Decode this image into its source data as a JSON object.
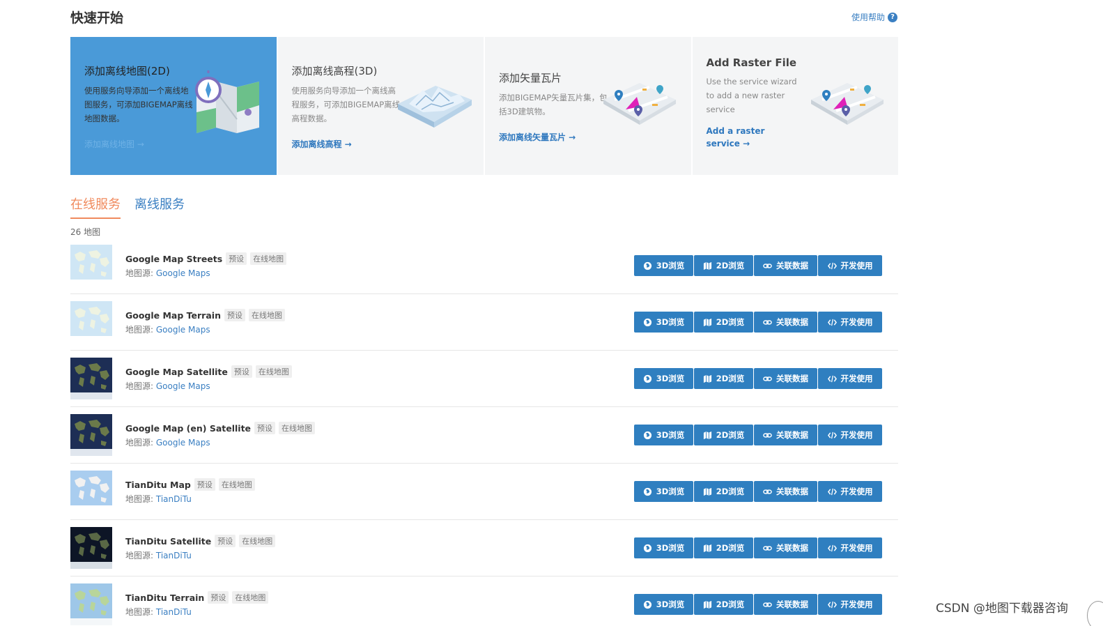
{
  "header": {
    "title": "快速开始",
    "help_label": "使用帮助",
    "help_icon": "question-circle-icon"
  },
  "cards": [
    {
      "title": "添加离线地图(2D)",
      "desc": "使用服务向导添加一个离线地图服务，可添加BIGEMAP离线地图数据。",
      "link": "添加离线地图 →"
    },
    {
      "title": "添加离线高程(3D)",
      "desc": "使用服务向导添加一个离线高程服务，可添加BIGEMAP离线高程数据。",
      "link": "添加离线高程 →"
    },
    {
      "title": "添加矢量瓦片",
      "desc": "添加BIGEMAP矢量瓦片集，包括3D建筑物。",
      "link": "添加离线矢量瓦片 →"
    },
    {
      "title": "Add Raster File",
      "desc": "Use the service wizard to add a new raster service",
      "link": "Add a raster service →"
    }
  ],
  "tabs": [
    {
      "label": "在线服务",
      "active": true
    },
    {
      "label": "离线服务",
      "active": false
    }
  ],
  "count_label": "26 地图",
  "source_prefix": "地图源: ",
  "buttons": {
    "view3d": "3D浏览",
    "view2d": "2D浏览",
    "link_data": "关联数据",
    "develop": "开发使用"
  },
  "maps": [
    {
      "name": "Google Map Streets",
      "tag_preset": "预设",
      "tag_type": "在线地图",
      "source": "Google Maps",
      "thumb": "light"
    },
    {
      "name": "Google Map Terrain",
      "tag_preset": "预设",
      "tag_type": "在线地图",
      "source": "Google Maps",
      "thumb": "light"
    },
    {
      "name": "Google Map Satellite",
      "tag_preset": "预设",
      "tag_type": "在线地图",
      "source": "Google Maps",
      "thumb": "dark"
    },
    {
      "name": "Google Map (en) Satellite",
      "tag_preset": "预设",
      "tag_type": "在线地图",
      "source": "Google Maps",
      "thumb": "dark"
    },
    {
      "name": "TianDitu Map",
      "tag_preset": "预设",
      "tag_type": "在线地图",
      "source": "TianDiTu",
      "thumb": "pale"
    },
    {
      "name": "TianDitu Satellite",
      "tag_preset": "预设",
      "tag_type": "在线地图",
      "source": "TianDiTu",
      "thumb": "night"
    },
    {
      "name": "TianDitu Terrain",
      "tag_preset": "预设",
      "tag_type": "在线地图",
      "source": "TianDiTu",
      "thumb": "terrain"
    }
  ],
  "colors": {
    "accent_blue": "#2f7fc0",
    "active_card": "#4a9ad8",
    "active_tab": "#f08a5d"
  },
  "watermark": "CSDN @地图下载器咨询"
}
